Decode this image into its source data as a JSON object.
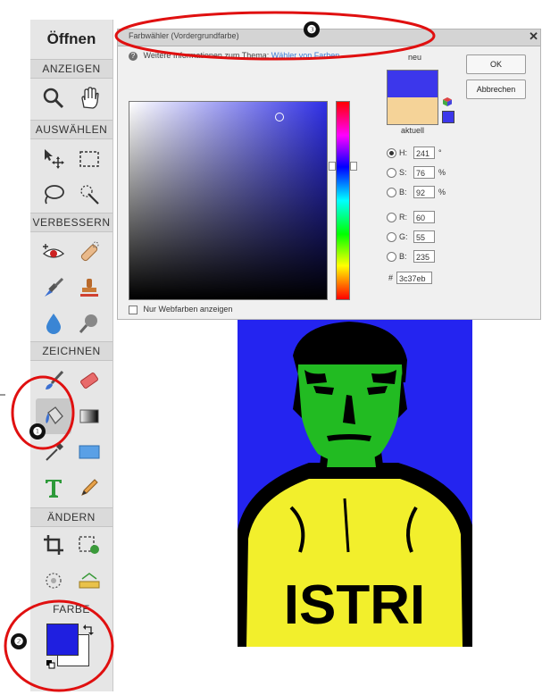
{
  "toolbar": {
    "title": "Öffnen",
    "sections": {
      "view": "ANZEIGEN",
      "select": "AUSWÄHLEN",
      "enhance": "VERBESSERN",
      "draw": "ZEICHNEN",
      "modify": "ÄNDERN",
      "color": "FARBE"
    },
    "foreground_color": "#1f1fe0",
    "background_color": "#ffffff"
  },
  "dialog": {
    "title": "Farbwähler (Vordergrundfarbe)",
    "info_text": "Weitere Informationen zum Thema:",
    "info_link": "Wähler von Farben",
    "ok_label": "OK",
    "cancel_label": "Abbrechen",
    "new_label": "neu",
    "current_label": "aktuell",
    "new_color": "#3c37eb",
    "current_color": "#f5d398",
    "webcolors_label": "Nur Webfarben anzeigen",
    "fields": {
      "h": {
        "label": "H:",
        "value": "241",
        "unit": "°"
      },
      "s": {
        "label": "S:",
        "value": "76",
        "unit": "%"
      },
      "b": {
        "label": "B:",
        "value": "92",
        "unit": "%"
      },
      "r": {
        "label": "R:",
        "value": "60"
      },
      "g": {
        "label": "G:",
        "value": "55"
      },
      "bb": {
        "label": "B:",
        "value": "235"
      }
    },
    "hex_label": "#",
    "hex_value": "3c37eb"
  },
  "annotations": {
    "one": "❶",
    "two": "❷",
    "three": "❸"
  },
  "photo": {
    "shirt_text": "ISTRI"
  }
}
